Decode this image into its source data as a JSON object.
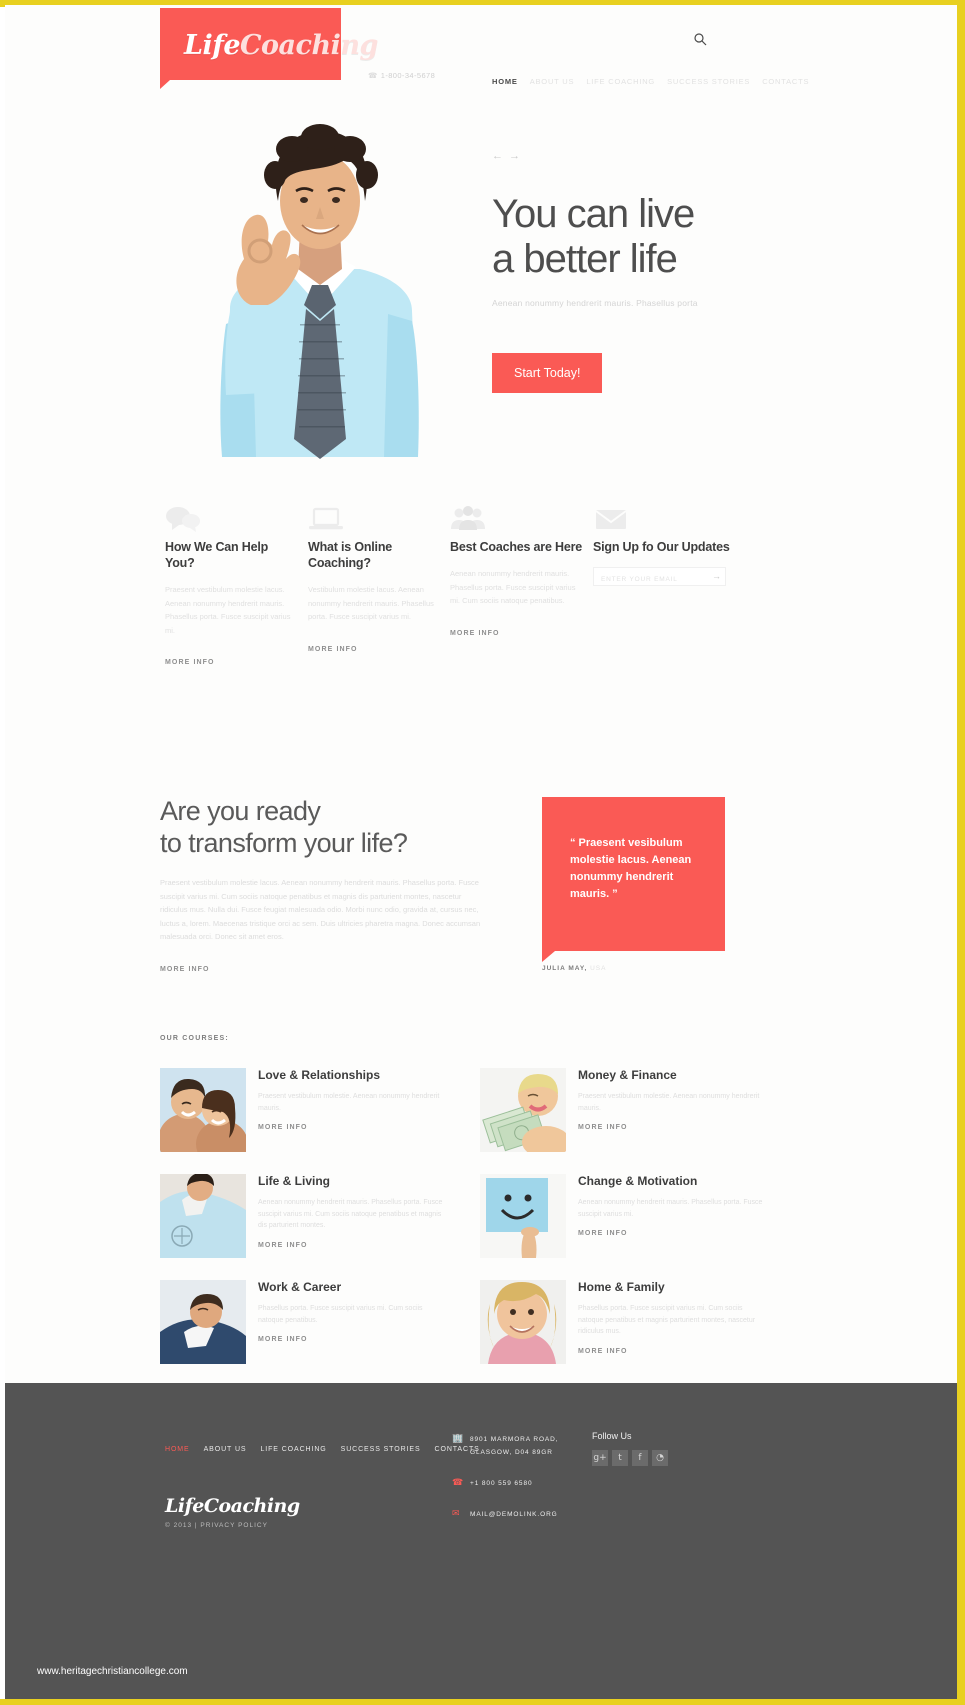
{
  "brand": {
    "name_bold": "Life",
    "name_light": "Coaching"
  },
  "header": {
    "search_icon": "search-icon",
    "phone_icon": "phone-icon",
    "phone": "1-800-34-5678",
    "nav": [
      {
        "label": "HOME",
        "active": true
      },
      {
        "label": "ABOUT US",
        "active": false
      },
      {
        "label": "LIFE COACHING",
        "active": false
      },
      {
        "label": "SUCCESS STORIES",
        "active": false
      },
      {
        "label": "CONTACTS",
        "active": false
      }
    ]
  },
  "hero": {
    "prev_arrow": "←",
    "next_arrow": "→",
    "title_line1": "You can live",
    "title_line2": "a better life",
    "subtitle": "Aenean nonummy hendrerit mauris. Phasellus porta",
    "cta_label": "Start Today!",
    "photo_alt": "smiling-man-ok-gesture"
  },
  "features": [
    {
      "icon": "chat-bubbles-icon",
      "title": "How We Can Help You?",
      "body": "Praesent vestibulum molestie lacus. Aenean nonummy hendrerit mauris. Phasellus porta. Fusce suscipit varius mi.",
      "link": "MORE INFO"
    },
    {
      "icon": "laptop-icon",
      "title": "What is Online Coaching?",
      "body": "Vestibulum molestie lacus. Aenean nonummy hendrerit mauris. Phasellus porta. Fusce suscipit varius mi.",
      "link": "MORE INFO"
    },
    {
      "icon": "people-group-icon",
      "title": "Best Coaches are Here",
      "body": "Aenean nonummy hendrerit mauris. Phasellus porta. Fusce suscipit varius mi. Cum sociis natoque penatibus.",
      "link": "MORE INFO"
    },
    {
      "icon": "envelope-icon",
      "title": "Sign Up fo Our Updates",
      "body": "",
      "link": ""
    }
  ],
  "subscribe": {
    "placeholder": "ENTER YOUR EMAIL",
    "value": "",
    "submit_icon": "→"
  },
  "transform": {
    "title_line1": "Are you ready",
    "title_line2": "to transform your life?",
    "body": "Praesent vestibulum molestie lacus. Aenean nonummy hendrerit mauris. Phasellus porta. Fusce suscipit varius mi. Cum sociis natoque penatibus et magnis dis parturient montes, nascetur ridiculus mus. Nulla dui. Fusce feugiat malesuada odio. Morbi nunc odio, gravida at, cursus nec, luctus a, lorem. Maecenas tristique orci ac sem. Duis ultricies pharetra magna. Donec accumsan malesuada orci. Donec sit amet eros.",
    "link": "MORE INFO",
    "quote": "“ Praesent vesibulum molestie lacus. Aenean nonummy hendrerit mauris. ”",
    "author": "JULIA MAY,",
    "author_meta": "USA"
  },
  "courses": {
    "label": "OUR COURSES:",
    "items": [
      {
        "thumb": "couple-embracing-photo",
        "title": "Love & Relationships",
        "body": "Praesent vestibulum molestie. Aenean nonummy hendrerit mauris.",
        "link": "MORE INFO"
      },
      {
        "thumb": "woman-holding-money-photo",
        "title": "Money & Finance",
        "body": "Praesent vestibulum molestie. Aenean nonummy hendrerit mauris.",
        "link": "MORE INFO"
      },
      {
        "thumb": "man-blue-shirt-photo",
        "title": "Life & Living",
        "body": "Aenean nonummy hendrerit mauris. Phasellus porta. Fusce suscipit varius mi. Cum sociis natoque penatibus et magnis dis parturient montes.",
        "link": "MORE INFO"
      },
      {
        "thumb": "smiley-face-sign-photo",
        "title": "Change & Motivation",
        "body": "Aenean nonummy hendrerit mauris. Phasellus porta. Fusce suscipit varius mi.",
        "link": "MORE INFO"
      },
      {
        "thumb": "man-looking-up-photo",
        "title": "Work & Career",
        "body": "Phasellus porta. Fusce suscipit varius mi. Cum sociis natoque penatibus.",
        "link": "MORE INFO"
      },
      {
        "thumb": "smiling-girl-photo",
        "title": "Home & Family",
        "body": "Phasellus porta. Fusce suscipit varius mi. Cum sociis natoque penatibus et magnis parturient montes, nascetur ridiculus mus.",
        "link": "MORE INFO"
      }
    ]
  },
  "footer": {
    "nav": [
      {
        "label": "HOME",
        "active": true
      },
      {
        "label": "ABOUT US",
        "active": false
      },
      {
        "label": "LIFE COACHING",
        "active": false
      },
      {
        "label": "SUCCESS STORIES",
        "active": false
      },
      {
        "label": "CONTACTS",
        "active": false
      }
    ],
    "contact": {
      "address_icon": "building-icon",
      "address_line1": "8901 MARMORA ROAD,",
      "address_line2": "GLASGOW, D04 89GR",
      "phone_icon": "phone-icon",
      "phone": "+1 800 559 6580",
      "mail_icon": "envelope-icon",
      "mail": "MAIL@DEMOLINK.ORG"
    },
    "follow": {
      "label": "Follow Us",
      "socials": [
        {
          "name": "google-plus-icon",
          "glyph": "g+"
        },
        {
          "name": "twitter-icon",
          "glyph": "t"
        },
        {
          "name": "facebook-icon",
          "glyph": "f"
        },
        {
          "name": "rss-icon",
          "glyph": "◔"
        }
      ]
    },
    "brand_bold": "Life",
    "brand_light": "Coaching",
    "copyright": "© 2013  |  ",
    "privacy_label": "PRIVACY POLICY"
  },
  "watermark": "www.heritagechristiancollege.com",
  "colors": {
    "accent": "#fa5a55",
    "frame": "#e8d020",
    "footer_bg": "#545454",
    "heading": "#3d3d3d"
  }
}
